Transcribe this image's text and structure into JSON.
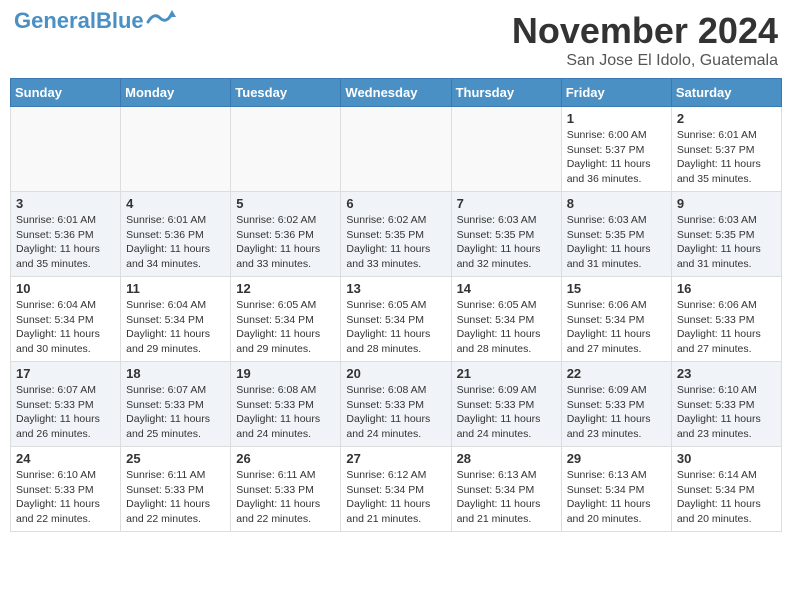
{
  "header": {
    "logo_general": "General",
    "logo_blue": "Blue",
    "month_title": "November 2024",
    "location": "San Jose El Idolo, Guatemala"
  },
  "days_of_week": [
    "Sunday",
    "Monday",
    "Tuesday",
    "Wednesday",
    "Thursday",
    "Friday",
    "Saturday"
  ],
  "weeks": [
    [
      {
        "day": "",
        "sunrise": "",
        "sunset": "",
        "daylight": "",
        "empty": true
      },
      {
        "day": "",
        "sunrise": "",
        "sunset": "",
        "daylight": "",
        "empty": true
      },
      {
        "day": "",
        "sunrise": "",
        "sunset": "",
        "daylight": "",
        "empty": true
      },
      {
        "day": "",
        "sunrise": "",
        "sunset": "",
        "daylight": "",
        "empty": true
      },
      {
        "day": "",
        "sunrise": "",
        "sunset": "",
        "daylight": "",
        "empty": true
      },
      {
        "day": "1",
        "sunrise": "Sunrise: 6:00 AM",
        "sunset": "Sunset: 5:37 PM",
        "daylight": "Daylight: 11 hours and 36 minutes.",
        "empty": false
      },
      {
        "day": "2",
        "sunrise": "Sunrise: 6:01 AM",
        "sunset": "Sunset: 5:37 PM",
        "daylight": "Daylight: 11 hours and 35 minutes.",
        "empty": false
      }
    ],
    [
      {
        "day": "3",
        "sunrise": "Sunrise: 6:01 AM",
        "sunset": "Sunset: 5:36 PM",
        "daylight": "Daylight: 11 hours and 35 minutes.",
        "empty": false
      },
      {
        "day": "4",
        "sunrise": "Sunrise: 6:01 AM",
        "sunset": "Sunset: 5:36 PM",
        "daylight": "Daylight: 11 hours and 34 minutes.",
        "empty": false
      },
      {
        "day": "5",
        "sunrise": "Sunrise: 6:02 AM",
        "sunset": "Sunset: 5:36 PM",
        "daylight": "Daylight: 11 hours and 33 minutes.",
        "empty": false
      },
      {
        "day": "6",
        "sunrise": "Sunrise: 6:02 AM",
        "sunset": "Sunset: 5:35 PM",
        "daylight": "Daylight: 11 hours and 33 minutes.",
        "empty": false
      },
      {
        "day": "7",
        "sunrise": "Sunrise: 6:03 AM",
        "sunset": "Sunset: 5:35 PM",
        "daylight": "Daylight: 11 hours and 32 minutes.",
        "empty": false
      },
      {
        "day": "8",
        "sunrise": "Sunrise: 6:03 AM",
        "sunset": "Sunset: 5:35 PM",
        "daylight": "Daylight: 11 hours and 31 minutes.",
        "empty": false
      },
      {
        "day": "9",
        "sunrise": "Sunrise: 6:03 AM",
        "sunset": "Sunset: 5:35 PM",
        "daylight": "Daylight: 11 hours and 31 minutes.",
        "empty": false
      }
    ],
    [
      {
        "day": "10",
        "sunrise": "Sunrise: 6:04 AM",
        "sunset": "Sunset: 5:34 PM",
        "daylight": "Daylight: 11 hours and 30 minutes.",
        "empty": false
      },
      {
        "day": "11",
        "sunrise": "Sunrise: 6:04 AM",
        "sunset": "Sunset: 5:34 PM",
        "daylight": "Daylight: 11 hours and 29 minutes.",
        "empty": false
      },
      {
        "day": "12",
        "sunrise": "Sunrise: 6:05 AM",
        "sunset": "Sunset: 5:34 PM",
        "daylight": "Daylight: 11 hours and 29 minutes.",
        "empty": false
      },
      {
        "day": "13",
        "sunrise": "Sunrise: 6:05 AM",
        "sunset": "Sunset: 5:34 PM",
        "daylight": "Daylight: 11 hours and 28 minutes.",
        "empty": false
      },
      {
        "day": "14",
        "sunrise": "Sunrise: 6:05 AM",
        "sunset": "Sunset: 5:34 PM",
        "daylight": "Daylight: 11 hours and 28 minutes.",
        "empty": false
      },
      {
        "day": "15",
        "sunrise": "Sunrise: 6:06 AM",
        "sunset": "Sunset: 5:34 PM",
        "daylight": "Daylight: 11 hours and 27 minutes.",
        "empty": false
      },
      {
        "day": "16",
        "sunrise": "Sunrise: 6:06 AM",
        "sunset": "Sunset: 5:33 PM",
        "daylight": "Daylight: 11 hours and 27 minutes.",
        "empty": false
      }
    ],
    [
      {
        "day": "17",
        "sunrise": "Sunrise: 6:07 AM",
        "sunset": "Sunset: 5:33 PM",
        "daylight": "Daylight: 11 hours and 26 minutes.",
        "empty": false
      },
      {
        "day": "18",
        "sunrise": "Sunrise: 6:07 AM",
        "sunset": "Sunset: 5:33 PM",
        "daylight": "Daylight: 11 hours and 25 minutes.",
        "empty": false
      },
      {
        "day": "19",
        "sunrise": "Sunrise: 6:08 AM",
        "sunset": "Sunset: 5:33 PM",
        "daylight": "Daylight: 11 hours and 24 minutes.",
        "empty": false
      },
      {
        "day": "20",
        "sunrise": "Sunrise: 6:08 AM",
        "sunset": "Sunset: 5:33 PM",
        "daylight": "Daylight: 11 hours and 24 minutes.",
        "empty": false
      },
      {
        "day": "21",
        "sunrise": "Sunrise: 6:09 AM",
        "sunset": "Sunset: 5:33 PM",
        "daylight": "Daylight: 11 hours and 24 minutes.",
        "empty": false
      },
      {
        "day": "22",
        "sunrise": "Sunrise: 6:09 AM",
        "sunset": "Sunset: 5:33 PM",
        "daylight": "Daylight: 11 hours and 23 minutes.",
        "empty": false
      },
      {
        "day": "23",
        "sunrise": "Sunrise: 6:10 AM",
        "sunset": "Sunset: 5:33 PM",
        "daylight": "Daylight: 11 hours and 23 minutes.",
        "empty": false
      }
    ],
    [
      {
        "day": "24",
        "sunrise": "Sunrise: 6:10 AM",
        "sunset": "Sunset: 5:33 PM",
        "daylight": "Daylight: 11 hours and 22 minutes.",
        "empty": false
      },
      {
        "day": "25",
        "sunrise": "Sunrise: 6:11 AM",
        "sunset": "Sunset: 5:33 PM",
        "daylight": "Daylight: 11 hours and 22 minutes.",
        "empty": false
      },
      {
        "day": "26",
        "sunrise": "Sunrise: 6:11 AM",
        "sunset": "Sunset: 5:33 PM",
        "daylight": "Daylight: 11 hours and 22 minutes.",
        "empty": false
      },
      {
        "day": "27",
        "sunrise": "Sunrise: 6:12 AM",
        "sunset": "Sunset: 5:34 PM",
        "daylight": "Daylight: 11 hours and 21 minutes.",
        "empty": false
      },
      {
        "day": "28",
        "sunrise": "Sunrise: 6:13 AM",
        "sunset": "Sunset: 5:34 PM",
        "daylight": "Daylight: 11 hours and 21 minutes.",
        "empty": false
      },
      {
        "day": "29",
        "sunrise": "Sunrise: 6:13 AM",
        "sunset": "Sunset: 5:34 PM",
        "daylight": "Daylight: 11 hours and 20 minutes.",
        "empty": false
      },
      {
        "day": "30",
        "sunrise": "Sunrise: 6:14 AM",
        "sunset": "Sunset: 5:34 PM",
        "daylight": "Daylight: 11 hours and 20 minutes.",
        "empty": false
      }
    ]
  ]
}
